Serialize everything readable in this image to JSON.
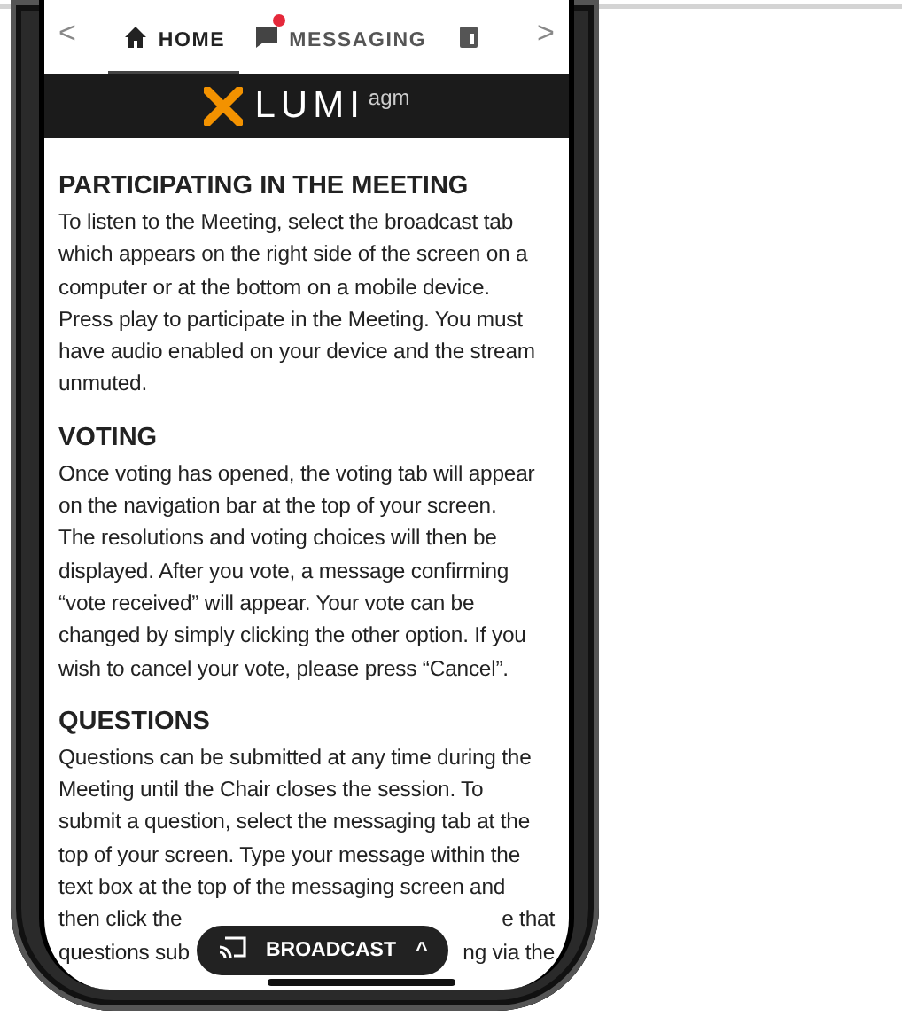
{
  "tabs": [
    {
      "label": "HOME",
      "selected": true,
      "badge": false
    },
    {
      "label": "MESSAGING",
      "selected": false,
      "badge": true
    },
    {
      "selected": false,
      "badge": false
    }
  ],
  "nav": {
    "prev": "<",
    "next": ">"
  },
  "brand": {
    "name": "LUMI",
    "suffix": "agm"
  },
  "sections": [
    {
      "heading": "PARTICIPATING IN THE MEETING",
      "lines": [
        "To listen to the Meeting, select the broadcast tab",
        "which appears on the right side of the screen on a",
        "computer or at the bottom on a mobile device.",
        "Press play to participate in the Meeting. You must",
        "have audio enabled on your device and the stream",
        "unmuted."
      ]
    },
    {
      "heading": "VOTING",
      "lines": [
        "Once voting has opened, the voting tab will appear",
        "on the navigation bar at the top of your screen.",
        "The resolutions and voting choices will then be",
        "displayed. After you vote, a message confirming",
        "“vote received” will appear. Your vote can be",
        "changed by simply clicking the other option. If you",
        "wish to cancel your vote, please press “Cancel”."
      ]
    },
    {
      "heading": "QUESTIONS",
      "lines": [
        "Questions can be submitted at any time during the",
        "Meeting until the Chair closes the session. To",
        "submit a question, select the messaging tab at the",
        "top of your screen. Type your message within the",
        "text box at the top of the messaging screen and"
      ],
      "cut_lines": [
        [
          "then click the",
          "e that"
        ],
        [
          "questions sub",
          "ng via the"
        ]
      ]
    }
  ],
  "broadcast": {
    "label": "BROADCAST",
    "caret": "^"
  }
}
